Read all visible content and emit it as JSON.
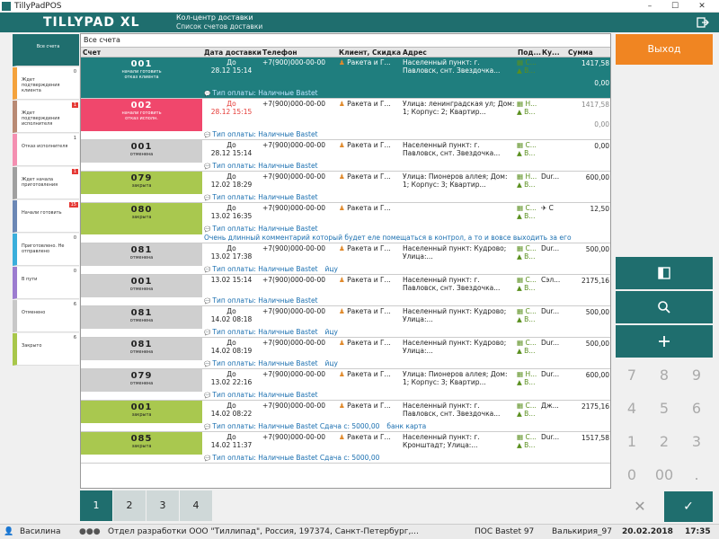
{
  "window": {
    "title": "TillyPadPOS",
    "min": "–",
    "max": "☐",
    "close": "✕"
  },
  "header": {
    "logo": "TILLYPAD XL",
    "title": "Кол-центр доставки",
    "subtitle": "Список счетов доставки"
  },
  "sidebar": [
    {
      "label": "Все счета",
      "count": "",
      "color": "#1f6e6e",
      "selected": true
    },
    {
      "label": "Ждет подтверждения клиента",
      "count": "0",
      "color": "#f4a23c",
      "red": false
    },
    {
      "label": "Ждет подтверждения исполнителя",
      "count": "1",
      "color": "#b98a74",
      "red": true
    },
    {
      "label": "Отказ исполнителя",
      "count": "1",
      "color": "#f48fb1",
      "red": false
    },
    {
      "label": "Ждет начала приготовления",
      "count": "1",
      "color": "#a0a0a0",
      "red": true
    },
    {
      "label": "Начали готовить",
      "count": "15",
      "color": "#6b87b5",
      "red": true
    },
    {
      "label": "Приготовлено. Не отправлено",
      "count": "0",
      "color": "#3aaedb",
      "red": false
    },
    {
      "label": "В пути",
      "count": "0",
      "color": "#9c7cd0",
      "red": false
    },
    {
      "label": "Отменено",
      "count": "6",
      "color": "#c8c8c8",
      "red": false
    },
    {
      "label": "Закрыто",
      "count": "6",
      "color": "#a8c74a",
      "red": false
    }
  ],
  "grid": {
    "title": "Все счета",
    "columns": [
      "Счет",
      "Дата доставки",
      "Телефон",
      "Клиент, Скидка",
      "Адрес",
      "Под...",
      "Ку...",
      "Сумма"
    ],
    "rows": [
      {
        "num": "001",
        "status": "начали готовить\nотказ клиента",
        "bg": "#1f7e7e",
        "fg": "#fff",
        "date1": "До",
        "date2": "28.12 15:14",
        "phone": "+7(900)000-00-00",
        "client": "Ракета и Г...",
        "addr": "Населенный пункт: г. Павловск, снт. Звездочка...",
        "pod": "▦ С...\n▲ В...",
        "ku": "",
        "sum": "1417,58\n\n0,00",
        "note": "Тип оплаты: Наличные Bastet",
        "note2": "",
        "h": 46,
        "rowbg": "#1f7e7e",
        "rowfg": "#fff"
      },
      {
        "num": "002",
        "status": "начали готовить\nотказ исполн.",
        "bg": "#f0476c",
        "fg": "#fff",
        "date1": "До",
        "date2": "28.12 15:15",
        "datered": true,
        "phone": "+7(900)000-00-00",
        "client": "Ракета и Г...",
        "addr": "Улица: ленинградская ул; Дом: 1; Корпус: 2; Квартир...",
        "pod": "▦ Н...\n▲ В...",
        "ku": "",
        "sum": "1417,58\n\n0,00",
        "sumgrey": true,
        "note": "Тип оплаты: Наличные Bastet",
        "note2": "",
        "h": 46
      },
      {
        "num": "001",
        "status": "отменена",
        "bg": "#cfcfcf",
        "fg": "#222",
        "date1": "До",
        "date2": "28.12 15:14",
        "phone": "+7(900)000-00-00",
        "client": "Ракета и Г...",
        "addr": "Населенный пункт: г. Павловск, снт. Звездочка...",
        "pod": "▦ С...\n▲ В...",
        "ku": "",
        "sum": "0,00",
        "note": "Тип оплаты: Наличные Bastet",
        "note2": "",
        "h": 35
      },
      {
        "num": "079",
        "status": "закрыта",
        "bg": "#a9c84f",
        "fg": "#222",
        "date1": "До",
        "date2": "12.02 18:29",
        "phone": "+7(900)000-00-00",
        "client": "Ракета и Г...",
        "addr": "Улица: Пионеров аллея; Дом: 1; Корпус: 3; Квартир...",
        "pod": "▦ Н...\n▲ В...",
        "ku": "Dur...",
        "sum": "600,00",
        "note": "Тип оплаты: Наличные Bastet",
        "note2": "",
        "h": 35
      },
      {
        "num": "080",
        "status": "закрыта",
        "bg": "#a9c84f",
        "fg": "#222",
        "date1": "До",
        "date2": "13.02 16:35",
        "phone": "+7(900)000-00-00",
        "client": "Ракета и Г...",
        "addr": "",
        "pod": "▦ С...\n▲ В...",
        "ku": "✈ С",
        "sum": "12,50",
        "note": "Тип оплаты: Наличные Bastet",
        "note2": "Очень длинный комментарий который будет еле помещаться в контрол, а то и вовсе выходить за его",
        "h": 45
      },
      {
        "num": "081",
        "status": "отменена",
        "bg": "#cfcfcf",
        "fg": "#222",
        "date1": "До",
        "date2": "13.02 17:38",
        "phone": "+7(900)000-00-00",
        "client": "Ракета и Г...",
        "addr": "Населенный пункт: Кудрово; Улица:...",
        "pod": "▦ С...\n▲ В...",
        "ku": "Dur...",
        "sum": "500,00",
        "note": "Тип оплаты: Наличные Bastet",
        "note2": "йцу",
        "h": 35
      },
      {
        "num": "001",
        "status": "отменена",
        "bg": "#cfcfcf",
        "fg": "#222",
        "date1": "",
        "date2": "13.02 15:14",
        "phone": "+7(900)000-00-00",
        "client": "Ракета и Г...",
        "addr": "Населенный пункт: г. Павловск, снт. Звездочка...",
        "pod": "▦ С...\n▲ В...",
        "ku": "Сэл...",
        "sum": "2175,16",
        "note": "Тип оплаты: Наличные Bastet",
        "note2": "",
        "h": 35
      },
      {
        "num": "081",
        "status": "отменена",
        "bg": "#cfcfcf",
        "fg": "#222",
        "date1": "До",
        "date2": "14.02 08:18",
        "phone": "+7(900)000-00-00",
        "client": "Ракета и Г...",
        "addr": "Населенный пункт: Кудрово; Улица:...",
        "pod": "▦ С...\n▲ В...",
        "ku": "Dur...",
        "sum": "500,00",
        "note": "Тип оплаты: Наличные Bastet",
        "note2": "йцу",
        "h": 35
      },
      {
        "num": "081",
        "status": "отменена",
        "bg": "#cfcfcf",
        "fg": "#222",
        "date1": "До",
        "date2": "14.02 08:19",
        "phone": "+7(900)000-00-00",
        "client": "Ракета и Г...",
        "addr": "Населенный пункт: Кудрово; Улица:...",
        "pod": "▦ С...\n▲ В...",
        "ku": "Dur...",
        "sum": "500,00",
        "note": "Тип оплаты: Наличные Bastet",
        "note2": "йцу",
        "h": 35
      },
      {
        "num": "079",
        "status": "отменена",
        "bg": "#cfcfcf",
        "fg": "#222",
        "date1": "До",
        "date2": "13.02 22:16",
        "phone": "+7(900)000-00-00",
        "client": "Ракета и Г...",
        "addr": "Улица: Пионеров аллея; Дом: 1; Корпус: 3; Квартир...",
        "pod": "▦ Н...\n▲ В...",
        "ku": "Dur...",
        "sum": "600,00",
        "note": "Тип оплаты: Наличные Bastet",
        "note2": "",
        "h": 35
      },
      {
        "num": "001",
        "status": "закрыта",
        "bg": "#a9c84f",
        "fg": "#222",
        "date1": "До",
        "date2": "14.02 08:22",
        "phone": "+7(900)000-00-00",
        "client": "Ракета и Г...",
        "addr": "Населенный пункт: г. Павловск, снт. Звездочка...",
        "pod": "▦ С...\n▲ В...",
        "ku": "Дж...",
        "sum": "2175,16",
        "note": "Тип оплаты: Наличные Bastet Сдача с: 5000,00",
        "note2": "банк карта",
        "h": 35
      },
      {
        "num": "085",
        "status": "закрыта",
        "bg": "#a9c84f",
        "fg": "#222",
        "date1": "До",
        "date2": "14.02 11:37",
        "phone": "+7(900)000-00-00",
        "client": "Ракета и Г...",
        "addr": "Населенный пункт: г. Кронштадт; Улица:...",
        "pod": "▦ С...\n▲ В...",
        "ku": "Dur...",
        "sum": "1517,58",
        "note": "Тип оплаты: Наличные Bastet Сдача с: 5000,00",
        "note2": "",
        "h": 35
      }
    ]
  },
  "pager": [
    "1",
    "2",
    "3",
    "4"
  ],
  "right": {
    "exit": "Выход",
    "keys": [
      "7",
      "8",
      "9",
      "4",
      "5",
      "6",
      "1",
      "2",
      "3",
      "0",
      "00",
      "."
    ],
    "cancel": "✕",
    "ok": "✓"
  },
  "status": {
    "user": "Василина",
    "org": "Отдел разработки ООО \"Тиллипад\", Россия, 197374, Санкт-Петербург,...",
    "pos": "ПОС Bastet 97",
    "terminal": "Валькирия_97",
    "date": "20.02.2018",
    "time": "17:35"
  }
}
